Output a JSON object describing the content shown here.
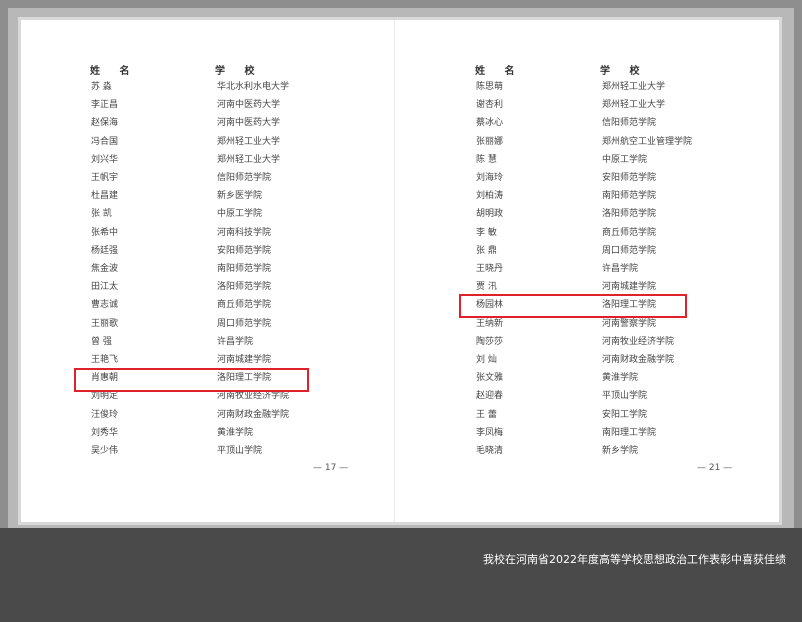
{
  "caption": "我校在河南省2022年度高等学校思想政治工作表彰中喜获佳绩",
  "left_page": {
    "header_name": "姓 名",
    "header_school": "学 校",
    "page_number": "— 17 —",
    "rows": [
      {
        "name": "苏 淼",
        "school": "华北水利水电大学"
      },
      {
        "name": "李正昌",
        "school": "河南中医药大学"
      },
      {
        "name": "赵保海",
        "school": "河南中医药大学"
      },
      {
        "name": "冯合国",
        "school": "郑州轻工业大学"
      },
      {
        "name": "刘兴华",
        "school": "郑州轻工业大学"
      },
      {
        "name": "王帆宇",
        "school": "信阳师范学院"
      },
      {
        "name": "杜昌建",
        "school": "新乡医学院"
      },
      {
        "name": "张 凯",
        "school": "中原工学院"
      },
      {
        "name": "张希中",
        "school": "河南科技学院"
      },
      {
        "name": "杨廷强",
        "school": "安阳师范学院"
      },
      {
        "name": "焦金波",
        "school": "南阳师范学院"
      },
      {
        "name": "田江太",
        "school": "洛阳师范学院"
      },
      {
        "name": "曹志诚",
        "school": "商丘师范学院"
      },
      {
        "name": "王丽歌",
        "school": "周口师范学院"
      },
      {
        "name": "曾 强",
        "school": "许昌学院"
      },
      {
        "name": "王艳飞",
        "school": "河南城建学院"
      },
      {
        "name": "肖惠朝",
        "school": "洛阳理工学院"
      },
      {
        "name": "刘明定",
        "school": "河南牧业经济学院"
      },
      {
        "name": "汪俊玲",
        "school": "河南财政金融学院"
      },
      {
        "name": "刘秀华",
        "school": "黄淮学院"
      },
      {
        "name": "吴少伟",
        "school": "平顶山学院"
      }
    ]
  },
  "right_page": {
    "header_name": "姓 名",
    "header_school": "学 校",
    "page_number": "— 21 —",
    "rows": [
      {
        "name": "陈思萌",
        "school": "郑州轻工业大学"
      },
      {
        "name": "谢杏利",
        "school": "郑州轻工业大学"
      },
      {
        "name": "蔡冰心",
        "school": "信阳师范学院"
      },
      {
        "name": "张丽娜",
        "school": "郑州航空工业管理学院"
      },
      {
        "name": "陈 慧",
        "school": "中原工学院"
      },
      {
        "name": "刘海玲",
        "school": "安阳师范学院"
      },
      {
        "name": "刘柏涛",
        "school": "南阳师范学院"
      },
      {
        "name": "胡明政",
        "school": "洛阳师范学院"
      },
      {
        "name": "李 敏",
        "school": "商丘师范学院"
      },
      {
        "name": "张 鼎",
        "school": "周口师范学院"
      },
      {
        "name": "王晓丹",
        "school": "许昌学院"
      },
      {
        "name": "贾 汛",
        "school": "河南城建学院"
      },
      {
        "name": "杨园林",
        "school": "洛阳理工学院"
      },
      {
        "name": "王纳新",
        "school": "河南警察学院"
      },
      {
        "name": "陶莎莎",
        "school": "河南牧业经济学院"
      },
      {
        "name": "刘 灿",
        "school": "河南财政金融学院"
      },
      {
        "name": "张文雅",
        "school": "黄淮学院"
      },
      {
        "name": "赵迎春",
        "school": "平顶山学院"
      },
      {
        "name": "王 蕾",
        "school": "安阳工学院"
      },
      {
        "name": "李凤梅",
        "school": "南阳理工学院"
      },
      {
        "name": "毛晓清",
        "school": "新乡学院"
      }
    ]
  }
}
